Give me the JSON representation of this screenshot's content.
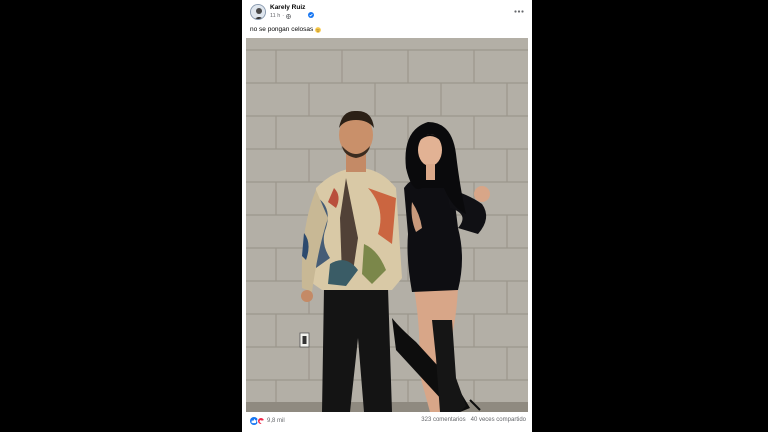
{
  "post": {
    "author": "Karely Ruiz",
    "time": "11 h",
    "separator": "·",
    "caption": "no se pongan celosas",
    "caption_emoji": "winking-face-icon",
    "more_icon": "more-options-icon",
    "verified_icon": "verified-badge-icon",
    "privacy_icon": "globe-icon"
  },
  "footer": {
    "reaction_count": "9,8 mil",
    "comments": "323 comentarios",
    "shares": "40 veces compartido",
    "reaction_icons": [
      "like-icon",
      "love-icon"
    ]
  },
  "colors": {
    "background": "#000000",
    "card": "#ffffff",
    "primary_text": "#050505",
    "secondary_text": "#65676b",
    "like_blue": "#1877f2",
    "love_red": "#f0284a"
  }
}
